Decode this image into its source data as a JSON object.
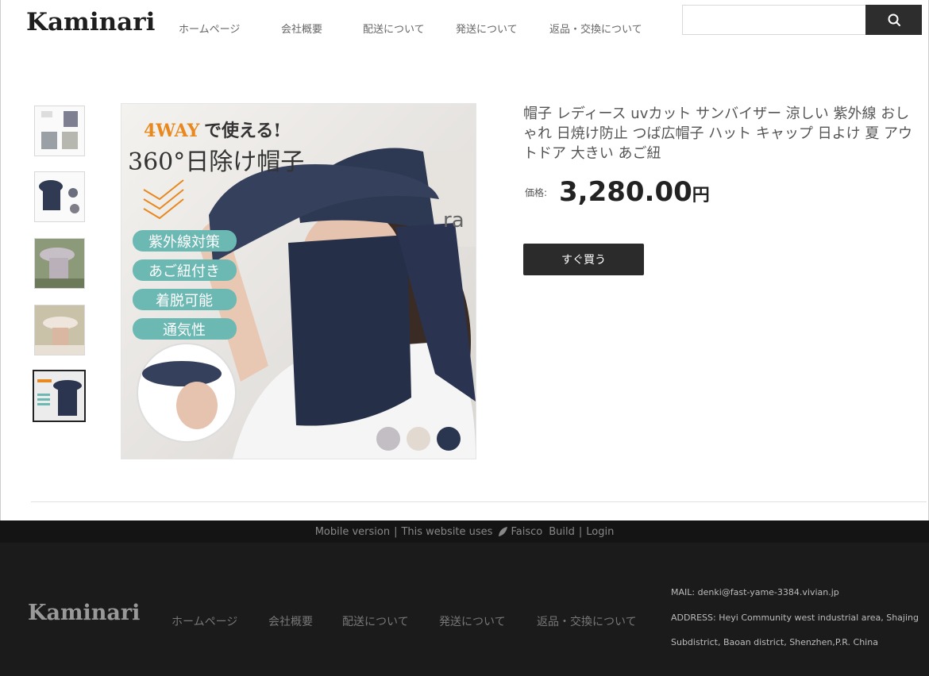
{
  "header": {
    "logo": "Kaminari",
    "nav": [
      "ホームページ",
      "会社概要",
      "配送について",
      "発送について",
      "返品・交換について"
    ],
    "search": {
      "placeholder": "",
      "icon": "search-icon"
    }
  },
  "product": {
    "thumbnails": [
      "thumbnail-1",
      "thumbnail-2",
      "thumbnail-3",
      "thumbnail-4",
      "thumbnail-5"
    ],
    "active_thumbnail": 4,
    "image_text": {
      "headline_brand": "4WAY",
      "headline_rest": "で使える!",
      "subheadline": "360°日除け帽子",
      "features": [
        "紫外線対策",
        "あご紐付き",
        "着脱可能",
        "通気性"
      ],
      "hat_print": "ra",
      "color_swatches": [
        "#c3bdc4",
        "#e2d9d0",
        "#2a3550"
      ]
    },
    "title": "帽子 レディース uvカット サンバイザー 涼しい 紫外線 おしゃれ 日焼け防止 つば広帽子 ハット キャップ 日よけ 夏 アウトドア 大きい あご紐",
    "price_label": "価格:",
    "price": "3,280.00",
    "currency": "円",
    "buy_label": "すぐ買う"
  },
  "footer": {
    "mobile": "Mobile version",
    "site_uses": "This website uses",
    "brand": "Faisco",
    "build": "Build",
    "login": "Login",
    "logo": "Kaminari",
    "nav": [
      "ホームページ",
      "会社概要",
      "配送について",
      "発送について",
      "返品・交換について"
    ],
    "mail_label": "MAIL:",
    "mail": "denki@fast-yame-3384.vivian.jp",
    "address_label": "ADDRESS:",
    "address_line1": "Heyi Community west industrial area, Shajing",
    "address_line2": "Subdistrict, Baoan district, Shenzhen,P.R. China"
  },
  "colors": {
    "accent": "#2b2b2b",
    "footer_bg": "#1b1b1b",
    "feature_pill": "#6cb8b3",
    "headline_orange": "#e8891f"
  }
}
